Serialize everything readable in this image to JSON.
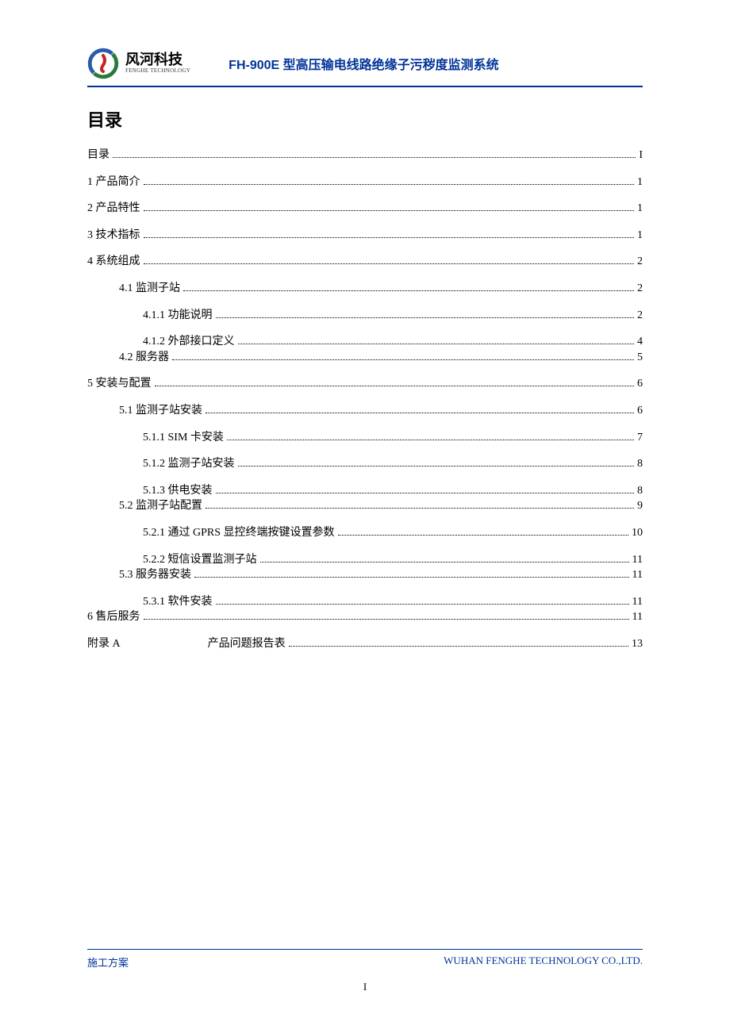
{
  "header": {
    "company_name": "风河科技",
    "company_sub": "FENGHE TECHNOLOGY",
    "doc_title": "FH-900E 型高压输电线路绝缘子污秽度监测系统"
  },
  "section_title": "目录",
  "toc": {
    "item0": {
      "label": "目录",
      "page": "I"
    },
    "item1": {
      "label": "1  产品简介",
      "page": "1"
    },
    "item2": {
      "label": "2  产品特性",
      "page": "1"
    },
    "item3": {
      "label": "3  技术指标",
      "page": "1"
    },
    "item4": {
      "label": "4  系统组成",
      "page": "2"
    },
    "item4_1": {
      "label": "4.1 监测子站",
      "page": "2"
    },
    "item4_1_1": {
      "label": "4.1.1 功能说明",
      "page": "2"
    },
    "item4_1_2": {
      "label": "4.1.2 外部接口定义",
      "page": "4"
    },
    "item4_2": {
      "label": "4.2 服务器",
      "page": "5"
    },
    "item5": {
      "label": "5  安装与配置",
      "page": "6"
    },
    "item5_1": {
      "label": "5.1  监测子站安装",
      "page": "6"
    },
    "item5_1_1": {
      "label": "5.1.1 SIM 卡安装",
      "page": "7"
    },
    "item5_1_2": {
      "label": "5.1.2  监测子站安装",
      "page": "8"
    },
    "item5_1_3": {
      "label": "5.1.3  供电安装",
      "page": "8"
    },
    "item5_2": {
      "label": "5.2 监测子站配置",
      "page": "9"
    },
    "item5_2_1": {
      "label": "5.2.1 通过 GPRS 显控终端按键设置参数",
      "page": "10"
    },
    "item5_2_2": {
      "label": "5.2.2 短信设置监测子站",
      "page": "11"
    },
    "item5_3": {
      "label": "5.3  服务器安装",
      "page": "11"
    },
    "item5_3_1": {
      "label": "5.3.1 软件安装",
      "page": "11"
    },
    "item6": {
      "label": "6 售后服务",
      "page": "11"
    },
    "appendix": {
      "label": "附录 A",
      "label2": "产品问题报告表",
      "page": "13"
    }
  },
  "footer": {
    "left": "施工方案",
    "right": "WUHAN FENGHE TECHNOLOGY CO.,LTD."
  },
  "page_number": "I"
}
